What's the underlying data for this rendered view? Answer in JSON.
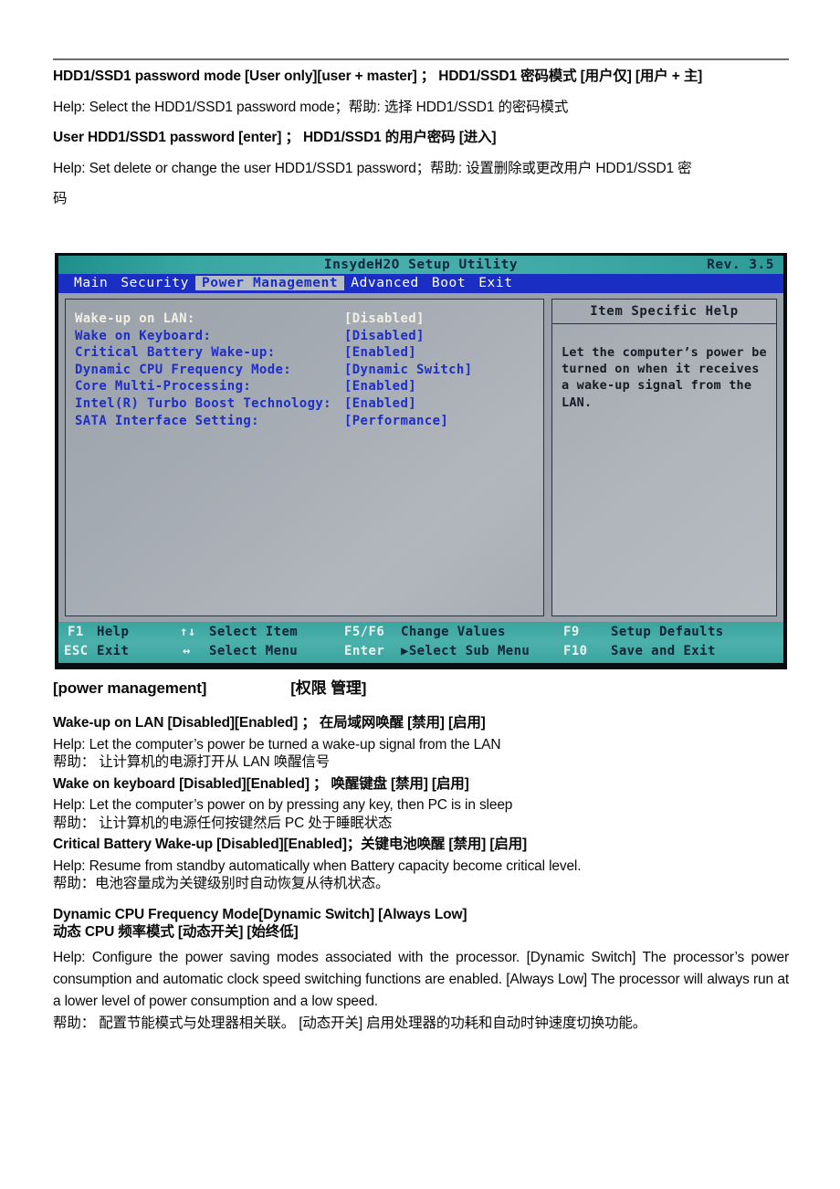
{
  "document": {
    "top_section": [
      {
        "id": "hdd-mode-heading",
        "bold": true,
        "text": "HDD1/SSD1 password mode [User only][user + master] ； HDD1/SSD1 密码模式 [用户仅] [用户 + 主]"
      },
      {
        "id": "hdd-mode-help",
        "bold": false,
        "text": "Help: Select the HDD1/SSD1 password mode；帮助: 选择 HDD1/SSD1 的密码模式"
      },
      {
        "id": "user-hdd-password-heading",
        "bold": true,
        "text": "User HDD1/SSD1 password [enter] ； HDD1/SSD1 的用户密码 [进入]"
      },
      {
        "id": "user-hdd-password-help",
        "bold": false,
        "text": "Help: Set delete or change the user HDD1/SSD1 password；帮助: 设置删除或更改用户 HDD1/SSD1 密"
      },
      {
        "id": "user-hdd-password-help-cont",
        "bold": false,
        "text": "码"
      }
    ],
    "bottom_section": {
      "section_heading_en": "[power management]",
      "section_heading_zh": "[权限 管理]",
      "items": [
        {
          "id": "wake-up-on-lan",
          "heading": "Wake-up on LAN     [Disabled][Enabled] ；    在局域网唤醒 [禁用] [启用]",
          "help_en": "Help: Let the computer’s power be turned a wake-up signal from the LAN",
          "help_zh": "帮助： 让计算机的电源打开从 LAN 唤醒信号"
        },
        {
          "id": "wake-on-keyboard",
          "heading": "Wake on keyboard   [Disabled][Enabled] ；    唤醒键盘 [禁用] [启用]",
          "help_en": "Help: Let the computer’s power on by pressing any key, then PC is in sleep",
          "help_zh": "帮助： 让计算机的电源任何按键然后 PC 处于睡眠状态"
        },
        {
          "id": "critical-battery-wake-up",
          "heading": "Critical Battery Wake-up [Disabled][Enabled]；关键电池唤醒 [禁用] [启用]",
          "help_en": "Help: Resume from standby automatically when Battery capacity become critical level.",
          "help_zh": "帮助：电池容量成为关键级别时自动恢复从待机状态。"
        },
        {
          "id": "dynamic-cpu-frequency-mode",
          "heading": "Dynamic CPU Frequency Mode[Dynamic Switch] [Always Low]",
          "heading_zh": "动态 CPU 频率模式 [动态开关] [始终低]",
          "help_en": "Help: Configure the power saving modes associated with the processor. [Dynamic Switch] The processor’s power consumption and automatic clock speed switching functions are enabled. [Always Low] The processor will always run at a lower level of power consumption and a low speed.",
          "help_zh": "帮助： 配置节能模式与处理器相关联。 [动态开关] 启用处理器的功耗和自动时钟速度切换功能。"
        }
      ]
    }
  },
  "bios_screenshot": {
    "title": "InsydeH2O Setup Utility",
    "revision": "Rev. 3.5",
    "menu_items": [
      {
        "label": "Main",
        "active": false
      },
      {
        "label": "Security",
        "active": false
      },
      {
        "label": "Power Management",
        "active": true
      },
      {
        "label": "Advanced",
        "active": false
      },
      {
        "label": "Boot",
        "active": false
      },
      {
        "label": "Exit",
        "active": false
      }
    ],
    "settings": [
      {
        "label": "Wake-up on LAN:",
        "value": "[Disabled]",
        "selected": true
      },
      {
        "label": "Wake on Keyboard:",
        "value": "[Disabled]",
        "selected": false
      },
      {
        "label": "Critical Battery Wake-up:",
        "value": "[Enabled]",
        "selected": false
      },
      {
        "label": "Dynamic CPU Frequency Mode:",
        "value": "[Dynamic Switch]",
        "selected": false
      },
      {
        "label": "Core Multi-Processing:",
        "value": "[Enabled]",
        "selected": false
      },
      {
        "label": "Intel(R) Turbo Boost Technology:",
        "value": "[Enabled]",
        "selected": false
      },
      {
        "label": "SATA Interface Setting:",
        "value": "[Performance]",
        "selected": false
      }
    ],
    "help_panel": {
      "title": "Item Specific Help",
      "text": "Let the computer’s power be turned on when it receives a wake-up signal from the LAN."
    },
    "footer": {
      "row1": [
        {
          "key": "F1",
          "text": "Help"
        },
        {
          "key": "↑↓",
          "text": "Select Item"
        },
        {
          "key": "F5/F6",
          "text": "Change Values"
        },
        {
          "key": "F9",
          "text": "Setup Defaults"
        }
      ],
      "row2": [
        {
          "key": "ESC",
          "text": "Exit"
        },
        {
          "key": "↔",
          "text": "Select Menu"
        },
        {
          "key": "Enter",
          "text": "▶Select Sub Menu"
        },
        {
          "key": "F10",
          "text": "Save and Exit"
        }
      ]
    },
    "colors": {
      "titlebar": "#3aa7a2",
      "menubar": "#1b2ec4",
      "panel": "#a7adb4",
      "selected_text": "#f2efe4",
      "item_text": "#1f2ec6",
      "footer": "#44aca7"
    }
  }
}
